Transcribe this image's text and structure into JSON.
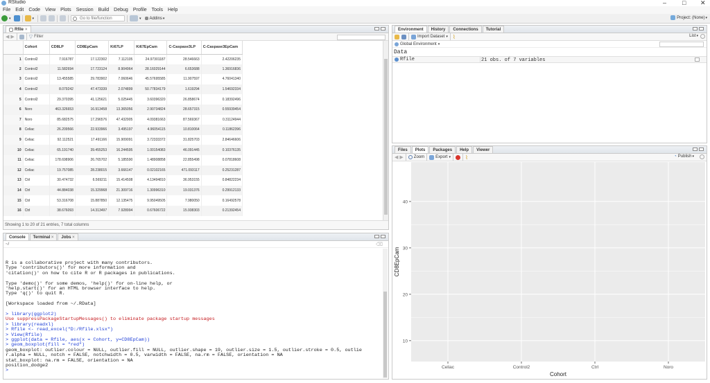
{
  "app": {
    "title": "RStudio",
    "project": "Project: (None)"
  },
  "menu": [
    "File",
    "Edit",
    "Code",
    "View",
    "Plots",
    "Session",
    "Build",
    "Debug",
    "Profile",
    "Tools",
    "Help"
  ],
  "toolbar": {
    "goto_placeholder": "Go to file/function",
    "addins": "Addins"
  },
  "data_viewer": {
    "tab": "Rfile",
    "filter_label": "Filter",
    "columns": [
      "Cohort",
      "CD8LP",
      "CD8EpCam",
      "Ki67LP",
      "Ki67EpCam",
      "C-Caspase3LP",
      "C-Caspase3EpCam"
    ],
    "rows": [
      [
        "1",
        "Control2",
        "7.916787",
        "17.122302",
        "7.112105",
        "24.97301187",
        "28.546663",
        "2.42206235"
      ],
      [
        "2",
        "Control2",
        "11.582694",
        "17.723124",
        "8.904964",
        "28.16029144",
        "6.653688",
        "1.36916836"
      ],
      [
        "3",
        "Control2",
        "13.455585",
        "29.783902",
        "7.060646",
        "45.57695585",
        "11.907597",
        "4.76041340"
      ],
      [
        "4",
        "Control2",
        "8.079242",
        "47.473339",
        "2.074899",
        "50.77834179",
        "1.619294",
        "1.54692334"
      ],
      [
        "5",
        "Control2",
        "29.370395",
        "41.125621",
        "5.025445",
        "3.60396320",
        "26.858674",
        "0.18392496"
      ],
      [
        "6",
        "Noro",
        "463.326653",
        "16.913458",
        "13.365056",
        "2.90734824",
        "28.657315",
        "0.55939454"
      ],
      [
        "7",
        "Noro",
        "85.682575",
        "17.296576",
        "47.432905",
        "4.09381663",
        "87.569367",
        "0.31124944"
      ],
      [
        "8",
        "Celiac",
        "26.209566",
        "22.933966",
        "3.495197",
        "4.96054115",
        "10.810064",
        "0.11862396"
      ],
      [
        "9",
        "Celiac",
        "92.112521",
        "17.491166",
        "15.909091",
        "3.72333372",
        "31.825703",
        "2.84646606"
      ],
      [
        "10",
        "Celiac",
        "65.191740",
        "39.455253",
        "16.244595",
        "1.00154083",
        "46.091445",
        "0.10376135"
      ],
      [
        "11",
        "Celiac",
        "178.698906",
        "26.765702",
        "5.185590",
        "1.48908858",
        "22.855498",
        "0.07818608"
      ],
      [
        "12",
        "Celiac",
        "19.757085",
        "28.238015",
        "3.666147",
        "0.02102165",
        "471.093117",
        "0.25231287"
      ],
      [
        "13",
        "Ctrl",
        "30.474732",
        "6.569211",
        "15.414508",
        "4.13494810",
        "36.953155",
        "0.84822234"
      ],
      [
        "14",
        "Ctrl",
        "44.884038",
        "15.329968",
        "21.309716",
        "1.30996310",
        "19.031376",
        "0.29912133"
      ],
      [
        "15",
        "Ctrl",
        "53.316708",
        "15.887850",
        "12.135475",
        "9.95049505",
        "7.980050",
        "0.16492578"
      ],
      [
        "16",
        "Ctrl",
        "38.676093",
        "14.313497",
        "7.928994",
        "0.67606722",
        "15.938303",
        "0.21392454"
      ]
    ],
    "status": "Showing 1 to 20 of 21 entries, 7 total columns"
  },
  "console": {
    "tabs": [
      "Console",
      "Terminal",
      "Jobs"
    ],
    "path": "~/",
    "lines": [
      {
        "t": "R is a collaborative project with many contributors.",
        "c": "ck"
      },
      {
        "t": "Type 'contributors()' for more information and",
        "c": "ck"
      },
      {
        "t": "'citation()' on how to cite R or R packages in publications.",
        "c": "ck"
      },
      {
        "t": "",
        "c": "ck"
      },
      {
        "t": "Type 'demo()' for some demos, 'help()' for on-line help, or",
        "c": "ck"
      },
      {
        "t": "'help.start()' for an HTML browser interface to help.",
        "c": "ck"
      },
      {
        "t": "Type 'q()' to quit R.",
        "c": "ck"
      },
      {
        "t": "",
        "c": "ck"
      },
      {
        "t": "[Workspace loaded from ~/.RData]",
        "c": "ck"
      },
      {
        "t": "",
        "c": "ck"
      },
      {
        "t": "> library(ggplot2)",
        "c": "cb"
      },
      {
        "t": "Use suppressPackageStartupMessages() to eliminate package startup messages",
        "c": "cr"
      },
      {
        "t": "> library(readxl)",
        "c": "cb"
      },
      {
        "t": "> Rfile <- read_excel(\"D:/Rfile.xlsx\")",
        "c": "cb"
      },
      {
        "t": "> View(Rfile)",
        "c": "cb"
      },
      {
        "t": "> ggplot(data = Rfile, aes(x = Cohort, y=CD8EpCam))",
        "c": "cb"
      },
      {
        "t": "> geom_boxplot(fill = \"red\")",
        "c": "cb"
      },
      {
        "t": "geom_boxplot: outlier.colour = NULL, outlier.fill = NULL, outlier.shape = 19, outlier.size = 1.5, outlier.stroke = 0.5, outlie",
        "c": "ck"
      },
      {
        "t": "r.alpha = NULL, notch = FALSE, notchwidth = 0.5, varwidth = FALSE, na.rm = FALSE, orientation = NA",
        "c": "ck"
      },
      {
        "t": "stat_boxplot: na.rm = FALSE, orientation = NA",
        "c": "ck"
      },
      {
        "t": "position_dodge2",
        "c": "ck"
      },
      {
        "t": ">",
        "c": "cb"
      }
    ]
  },
  "environment": {
    "tabs": [
      "Environment",
      "History",
      "Connections",
      "Tutorial"
    ],
    "import_label": "Import Dataset",
    "list_label": "List",
    "scope": "Global Environment",
    "section": "Data",
    "items": [
      {
        "name": "Rfile",
        "value": "21 obs. of 7 variables"
      }
    ]
  },
  "plots_pane": {
    "tabs": [
      "Files",
      "Plots",
      "Packages",
      "Help",
      "Viewer"
    ],
    "zoom_label": "Zoom",
    "export_label": "Export",
    "publish_label": "Publish"
  },
  "chart_data": {
    "type": "bar",
    "categories": [
      "Celiac",
      "Control2",
      "Ctrl",
      "Noro"
    ],
    "values": [],
    "xlabel": "Cohort",
    "ylabel": "CD8EpCam",
    "yticks": [
      10,
      20,
      30,
      40
    ],
    "ylim": [
      5.5,
      48.5
    ],
    "grid": true,
    "panel_color": "#ebebeb"
  }
}
